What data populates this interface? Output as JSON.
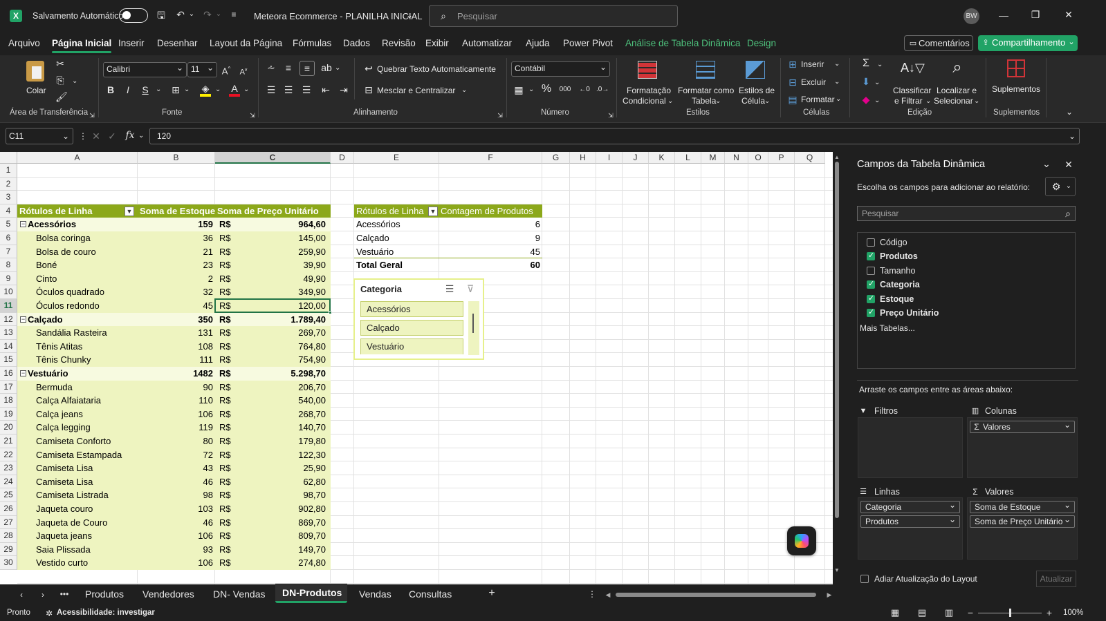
{
  "titlebar": {
    "autosave": "Salvamento Automático",
    "doc_title": "Meteora Ecommerce - PLANILHA INICIAL",
    "search_placeholder": "Pesquisar",
    "user_initials": "BW"
  },
  "menu": {
    "items": [
      "Arquivo",
      "Página Inicial",
      "Inserir",
      "Desenhar",
      "Layout da Página",
      "Fórmulas",
      "Dados",
      "Revisão",
      "Exibir",
      "Automatizar",
      "Ajuda",
      "Power Pivot",
      "Análise de Tabela Dinâmica",
      "Design"
    ],
    "comments": "Comentários",
    "share": "Compartilhamento"
  },
  "ribbon": {
    "clipboard": {
      "paste": "Colar",
      "label": "Área de Transferência"
    },
    "font": {
      "name": "Calibri",
      "size": "11",
      "label": "Fonte"
    },
    "alignment": {
      "wrap": "Quebrar Texto Automaticamente",
      "merge": "Mesclar e Centralizar",
      "label": "Alinhamento"
    },
    "number": {
      "format": "Contábil",
      "label": "Número"
    },
    "styles": {
      "conditional_1": "Formatação",
      "conditional_2": "Condicional",
      "table_1": "Formatar como",
      "table_2": "Tabela",
      "cell_1": "Estilos de",
      "cell_2": "Célula",
      "label": "Estilos"
    },
    "cells": {
      "insert": "Inserir",
      "delete": "Excluir",
      "format": "Formatar",
      "label": "Células"
    },
    "editing": {
      "sort_1": "Classificar",
      "sort_2": "e Filtrar",
      "find_1": "Localizar e",
      "find_2": "Selecionar",
      "label": "Edição"
    },
    "addins": {
      "button": "Suplementos",
      "label": "Suplementos"
    }
  },
  "formula": {
    "namebox": "C11",
    "value": "120"
  },
  "columns": [
    "A",
    "B",
    "C",
    "D",
    "E",
    "F",
    "G",
    "H",
    "I",
    "J",
    "K",
    "L",
    "M",
    "N",
    "O",
    "P",
    "Q"
  ],
  "rows": [
    "1",
    "2",
    "3",
    "4",
    "5",
    "6",
    "7",
    "8",
    "9",
    "10",
    "11",
    "12",
    "13",
    "14",
    "15",
    "16",
    "17",
    "18",
    "19",
    "20",
    "21",
    "22",
    "23",
    "24",
    "25",
    "26",
    "27",
    "28",
    "29",
    "30"
  ],
  "pivot1": {
    "headers": [
      "Rótulos de Linha",
      "Soma de Estoque",
      "Soma de Preço Unitário"
    ],
    "currency": "R$",
    "rows": [
      {
        "label": "Acessórios",
        "estoque": "159",
        "preco": "964,60",
        "group": true
      },
      {
        "label": "Bolsa coringa",
        "estoque": "36",
        "preco": "145,00"
      },
      {
        "label": "Bolsa de couro",
        "estoque": "21",
        "preco": "259,90"
      },
      {
        "label": "Boné",
        "estoque": "23",
        "preco": "39,90"
      },
      {
        "label": "Cinto",
        "estoque": "2",
        "preco": "49,90"
      },
      {
        "label": "Óculos quadrado",
        "estoque": "32",
        "preco": "349,90"
      },
      {
        "label": "Óculos redondo",
        "estoque": "45",
        "preco": "120,00"
      },
      {
        "label": "Calçado",
        "estoque": "350",
        "preco": "1.789,40",
        "group": true
      },
      {
        "label": "Sandália Rasteira",
        "estoque": "131",
        "preco": "269,70"
      },
      {
        "label": "Tênis Atitas",
        "estoque": "108",
        "preco": "764,80"
      },
      {
        "label": "Tênis Chunky",
        "estoque": "111",
        "preco": "754,90"
      },
      {
        "label": "Vestuário",
        "estoque": "1482",
        "preco": "5.298,70",
        "group": true
      },
      {
        "label": "Bermuda",
        "estoque": "90",
        "preco": "206,70"
      },
      {
        "label": "Calça Alfaiataria",
        "estoque": "110",
        "preco": "540,00"
      },
      {
        "label": "Calça jeans",
        "estoque": "106",
        "preco": "268,70"
      },
      {
        "label": "Calça legging",
        "estoque": "119",
        "preco": "140,70"
      },
      {
        "label": "Camiseta Conforto",
        "estoque": "80",
        "preco": "179,80"
      },
      {
        "label": "Camiseta Estampada",
        "estoque": "72",
        "preco": "122,30"
      },
      {
        "label": "Camiseta Lisa",
        "estoque": "43",
        "preco": "25,90"
      },
      {
        "label": "Camiseta Lisa",
        "estoque": "46",
        "preco": "62,80"
      },
      {
        "label": "Camiseta Listrada",
        "estoque": "98",
        "preco": "98,70"
      },
      {
        "label": "Jaqueta couro",
        "estoque": "103",
        "preco": "902,80"
      },
      {
        "label": "Jaqueta de Couro",
        "estoque": "46",
        "preco": "869,70"
      },
      {
        "label": "Jaqueta jeans",
        "estoque": "106",
        "preco": "809,70"
      },
      {
        "label": "Saia Plissada",
        "estoque": "93",
        "preco": "149,70"
      },
      {
        "label": "Vestido curto",
        "estoque": "106",
        "preco": "274,80"
      }
    ]
  },
  "pivot2": {
    "headers": [
      "Rótulos de Linha",
      "Contagem de Produtos"
    ],
    "rows": [
      {
        "label": "Acessórios",
        "count": "6"
      },
      {
        "label": "Calçado",
        "count": "9"
      },
      {
        "label": "Vestuário",
        "count": "45"
      }
    ],
    "total_label": "Total Geral",
    "total": "60"
  },
  "slicer": {
    "title": "Categoria",
    "items": [
      "Acessórios",
      "Calçado",
      "Vestuário"
    ]
  },
  "sheets": {
    "tabs": [
      "Produtos",
      "Vendedores",
      "DN- Vendas",
      "DN-Produtos",
      "Vendas",
      "Consultas"
    ],
    "active": "DN-Produtos"
  },
  "status": {
    "ready": "Pronto",
    "accessibility": "Acessibilidade: investigar",
    "zoom": "100%"
  },
  "panel": {
    "title": "Campos da Tabela Dinâmica",
    "subtitle": "Escolha os campos para adicionar ao relatório:",
    "search_placeholder": "Pesquisar",
    "fields": [
      {
        "name": "Código",
        "checked": false
      },
      {
        "name": "Produtos",
        "checked": true
      },
      {
        "name": "Tamanho",
        "checked": false
      },
      {
        "name": "Categoria",
        "checked": true
      },
      {
        "name": "Estoque",
        "checked": true
      },
      {
        "name": "Preço Unitário",
        "checked": true
      }
    ],
    "more": "Mais Tabelas...",
    "drag_hint": "Arraste os campos entre as áreas abaixo:",
    "filters": "Filtros",
    "columns": "Colunas",
    "rows": "Linhas",
    "values": "Valores",
    "columns_items": [
      "Valores"
    ],
    "rows_items": [
      "Categoria",
      "Produtos"
    ],
    "values_items": [
      "Soma de Estoque",
      "Soma de Preço Unitário"
    ],
    "defer": "Adiar Atualização do Layout",
    "update": "Atualizar"
  },
  "colors": {
    "accent": "#21a366",
    "pivot_header": "#8ca81a",
    "pivot_light": "#eef4c0"
  }
}
